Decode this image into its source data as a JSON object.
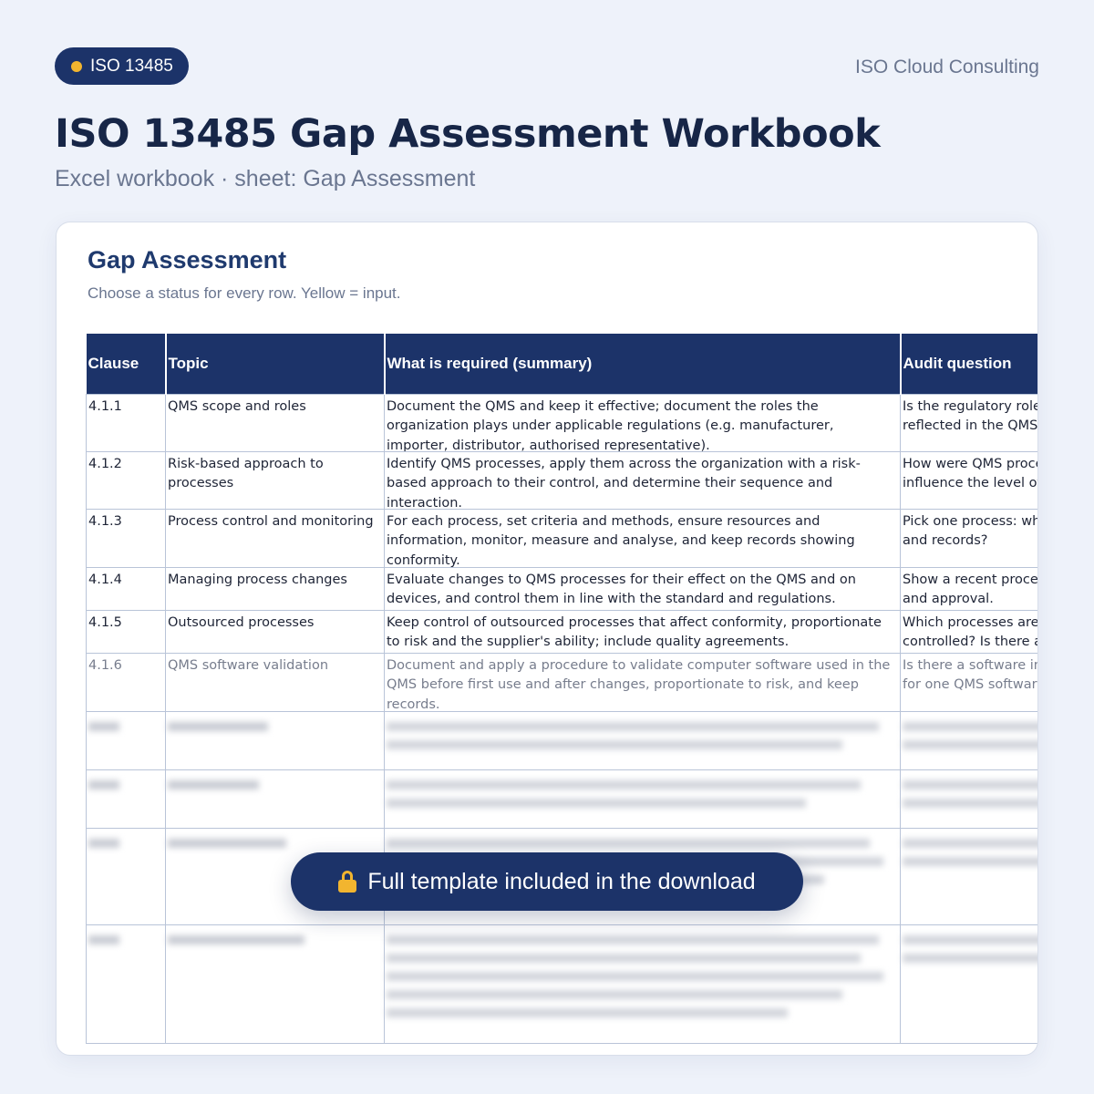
{
  "badge": {
    "label": "ISO 13485"
  },
  "brand": "ISO Cloud Consulting",
  "page_title": "ISO 13485 Gap Assessment Workbook",
  "page_subtitle": "Excel workbook  ·  sheet: Gap Assessment",
  "sheet": {
    "title": "Gap Assessment",
    "note": "Choose a status for every row. Yellow = input."
  },
  "table": {
    "columns": [
      "Clause",
      "Topic",
      "What is required (summary)",
      "Audit question"
    ],
    "rows": [
      {
        "clause": "4.1.1",
        "topic": "QMS scope and roles",
        "required": "Document the QMS and keep it effective; document the roles the organization plays under applicable regulations (e.g. manufacturer, importer, distributor, authorised representative).",
        "question_lines": [
          "Is the regulatory role",
          "reflected in the QMS"
        ]
      },
      {
        "clause": "4.1.2",
        "topic": "Risk-based approach to processes",
        "required": "Identify QMS processes, apply them across the organization with a risk-based approach to their control, and determine their sequence and interaction.",
        "question_lines": [
          "How were QMS proce",
          "influence the level of"
        ]
      },
      {
        "clause": "4.1.3",
        "topic": "Process control and monitoring",
        "required": "For each process, set criteria and methods, ensure resources and information, monitor, measure and analyse, and keep records showing conformity.",
        "question_lines": [
          "Pick one process: wh",
          "and records?"
        ]
      },
      {
        "clause": "4.1.4",
        "topic": "Managing process changes",
        "required": "Evaluate changes to QMS processes for their effect on the QMS and on devices, and control them in line with the standard and regulations.",
        "question_lines": [
          "Show a recent proces",
          "and approval."
        ]
      },
      {
        "clause": "4.1.5",
        "topic": "Outsourced processes",
        "required": "Keep control of outsourced processes that affect conformity, proportionate to risk and the supplier's ability; include quality agreements.",
        "question_lines": [
          "Which processes are",
          "controlled? Is there a"
        ]
      },
      {
        "clause": "4.1.6",
        "topic": "QMS software validation",
        "required": "Document and apply a procedure to validate computer software used in the QMS before first use and after changes, proportionate to risk, and keep records.",
        "question_lines": [
          "Is there a software in",
          "for one QMS softwar"
        ]
      }
    ]
  },
  "lock_bar": {
    "label": "Full template included in the download",
    "icon": "lock-icon"
  },
  "colors": {
    "navy": "#1c3369",
    "accent": "#f2b52f",
    "background": "#eef2fa"
  }
}
